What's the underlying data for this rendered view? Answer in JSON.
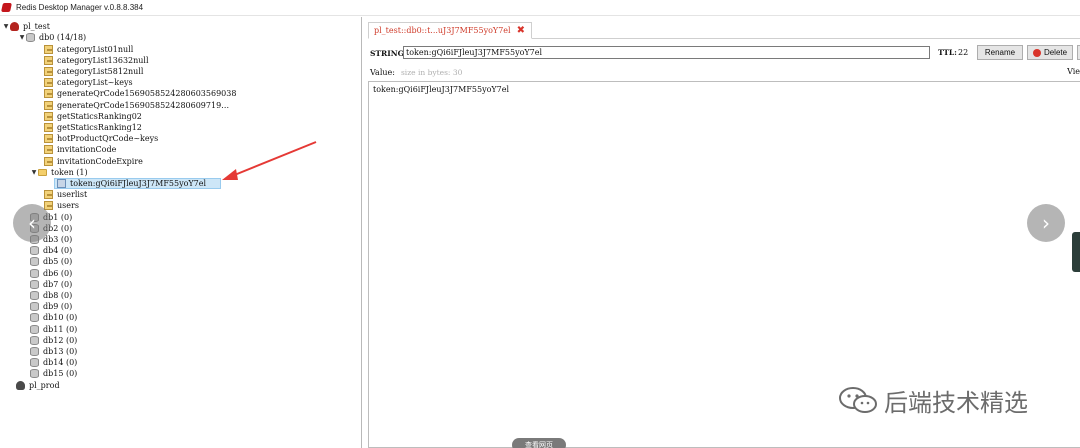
{
  "window": {
    "title": "Redis Desktop Manager v.0.8.8.384"
  },
  "tree": {
    "server1": {
      "label": "pl_test"
    },
    "db0": {
      "label": "db0  (14/18)"
    },
    "keys": [
      "categoryList01null",
      "categoryList13632null",
      "categoryList5812null",
      "categoryList~keys",
      "generateQrCode1569058524280603569038",
      "generateQrCode1569058524280609719…",
      "getStaticsRanking02",
      "getStaticsRanking12",
      "hotProductQrCode~keys",
      "invitationCode",
      "invitationCodeExpire"
    ],
    "folder": {
      "label": "token (1)"
    },
    "selected_key": {
      "label": "token:gQi6iFJleuJ3J7MF55yoY7el"
    },
    "keys_after": [
      "userlist",
      "users"
    ],
    "dbs": [
      "db1 (0)",
      "db2 (0)",
      "db3 (0)",
      "db4 (0)",
      "db5 (0)",
      "db6 (0)",
      "db7 (0)",
      "db8 (0)",
      "db9 (0)",
      "db10 (0)",
      "db11 (0)",
      "db12 (0)",
      "db13 (0)",
      "db14 (0)",
      "db15 (0)"
    ],
    "server2": {
      "label": "pl_prod"
    }
  },
  "tab": {
    "label": "pl_test::db0::t...uJ3J7MF55yoY7el",
    "close": "✖"
  },
  "key_editor": {
    "type_label": "STRING:",
    "key_value": "token:gQi6iFJleuJ3J7MF55yoY7el",
    "ttl_label": "TTL:",
    "ttl_value": "22",
    "rename_label": "Rename",
    "delete_label": "Delete",
    "value_label": "Value:",
    "value_hint": "size in bytes: 30",
    "view_label": "Vie",
    "value_content": "token:gQi6iFJleuJ3J7MF55yoY7el"
  },
  "overlay": {
    "prev": "‹",
    "next": "›",
    "watermark_text": "后端技术精选",
    "bottom_pill": "查看网页"
  },
  "colors": {
    "tab_text": "#cf3b2a",
    "selection": "#cde6f7",
    "annotation_arrow": "#e53935"
  }
}
